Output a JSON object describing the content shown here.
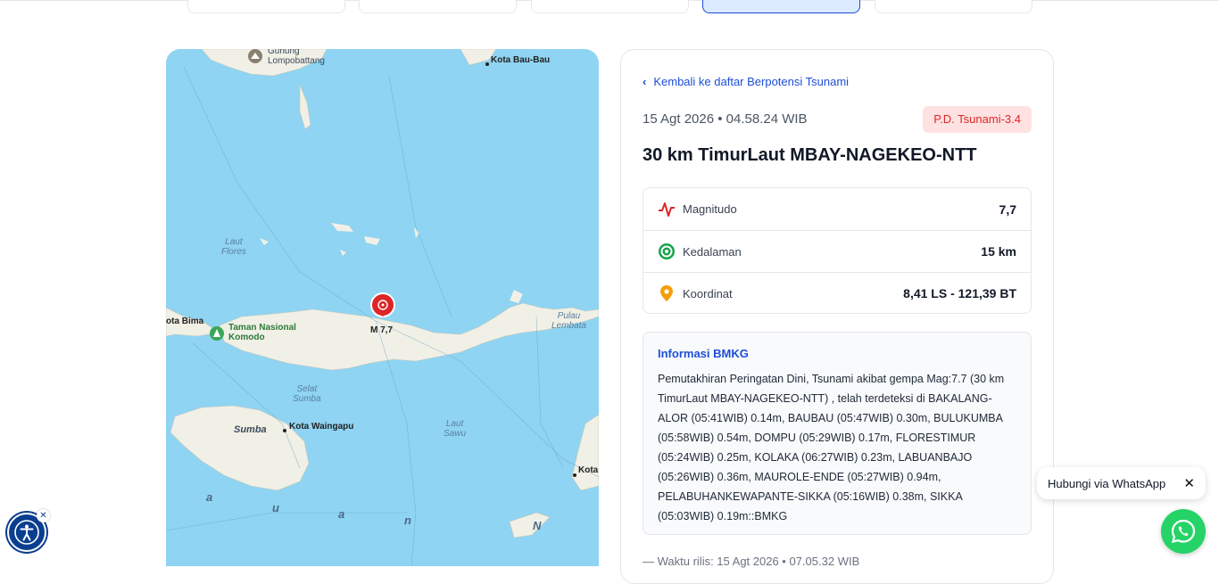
{
  "map": {
    "labels": {
      "gunung": "Gunung\nLompobattang",
      "baubau": "Kota Bau-Bau",
      "laut_flores": "Laut\nFlores",
      "bima": "ota Bima",
      "komodo": "Taman Nasional\nKomodo",
      "magnitude": "M 7,7",
      "pulau_lembata": "Pulau\nLembata",
      "selat_sumba": "Selat\nSumba",
      "sumba": "Sumba",
      "waingapu": "Kota Waingapu",
      "laut_sawu": "Laut\nSawu",
      "kota_right": "Kota",
      "a1": "a",
      "u": "u",
      "a2": "a",
      "n": "n",
      "N": "N"
    }
  },
  "event": {
    "back_link": "Kembali ke daftar Berpotensi Tsunami",
    "datetime": "15 Agt 2026 • 04.58.24 WIB",
    "badge": "P.D. Tsunami-3.4",
    "title": "30 km TimurLaut MBAY-NAGEKEO-NTT",
    "stats": [
      {
        "label": "Magnitudo",
        "value": "7,7",
        "icon": "pulse-icon"
      },
      {
        "label": "Kedalaman",
        "value": "15 km",
        "icon": "depth-target-icon"
      },
      {
        "label": "Koordinat",
        "value": "8,41 LS - 121,39 BT",
        "icon": "location-pin-icon"
      }
    ],
    "info_title": "Informasi BMKG",
    "info_text": "Pemutakhiran Peringatan Dini, Tsunami akibat gempa Mag:7.7 (30 km TimurLaut MBAY-NAGEKEO-NTT) , telah terdeteksi di BAKALANG-ALOR (05:41WIB) 0.14m, BAUBAU (05:47WIB) 0.30m, BULUKUMBA (05:58WIB) 0.54m, DOMPU (05:29WIB) 0.17m, FLORESTIMUR (05:24WIB) 0.25m, KOLAKA (06:27WIB) 0.23m, LABUANBAJO (05:26WIB) 0.36m, MAUROLE-ENDE (05:27WIB) 0.94m, PELABUHANKEWAPANTE-SIKKA (05:16WIB) 0.38m, SIKKA (05:03WIB) 0.19m::BMKG",
    "release": "— Waktu rilis: 15 Agt 2026 • 07.05.32 WIB"
  },
  "whatsapp": {
    "tooltip": "Hubungi via WhatsApp",
    "close": "✕"
  },
  "a11y": {
    "close": "✕"
  },
  "colors": {
    "accent": "#1d4ed8",
    "danger": "#dc2626",
    "sea": "#8fd4f2",
    "land": "#f1f0e6",
    "whatsapp": "#25d366"
  }
}
